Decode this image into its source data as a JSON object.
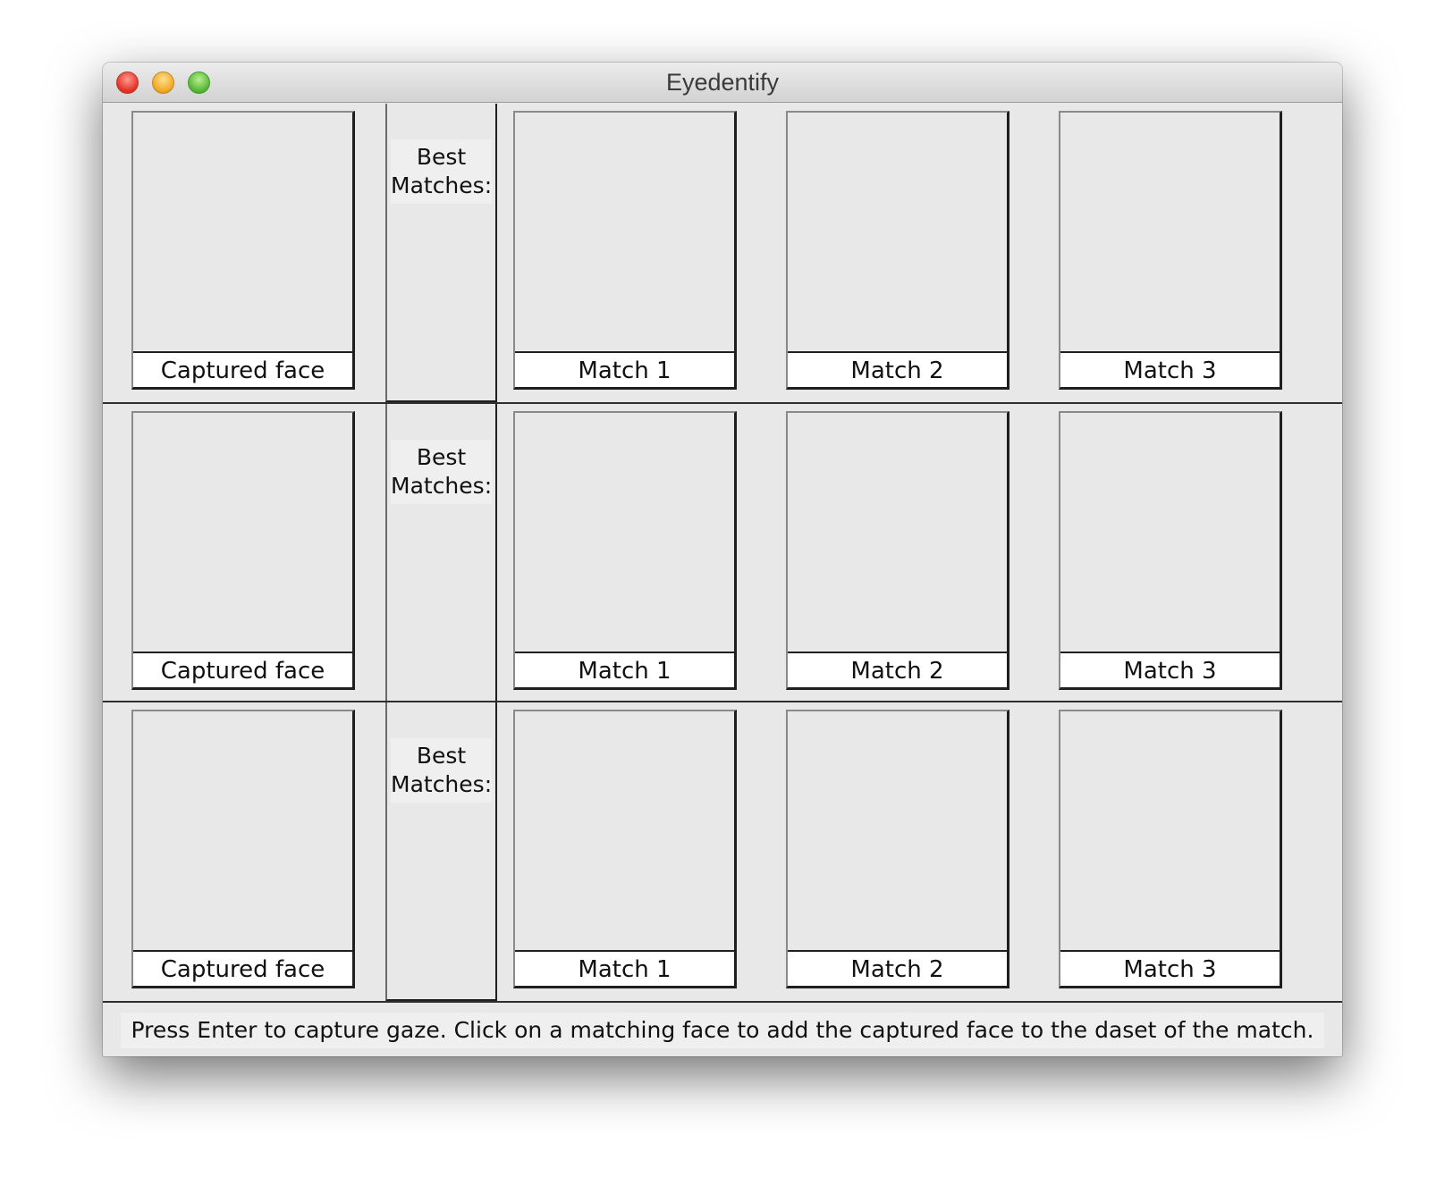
{
  "window": {
    "title": "Eyedentify"
  },
  "rows": [
    {
      "captured_label": "Captured face",
      "best_label": "Best Matches:",
      "matches": [
        "Match 1",
        "Match 2",
        "Match 3"
      ]
    },
    {
      "captured_label": "Captured face",
      "best_label": "Best Matches:",
      "matches": [
        "Match 1",
        "Match 2",
        "Match 3"
      ]
    },
    {
      "captured_label": "Captured face",
      "best_label": "Best Matches:",
      "matches": [
        "Match 1",
        "Match 2",
        "Match 3"
      ]
    }
  ],
  "status": {
    "message": "Press Enter to capture gaze. Click on a matching face to add the captured face to the daset of the match."
  }
}
